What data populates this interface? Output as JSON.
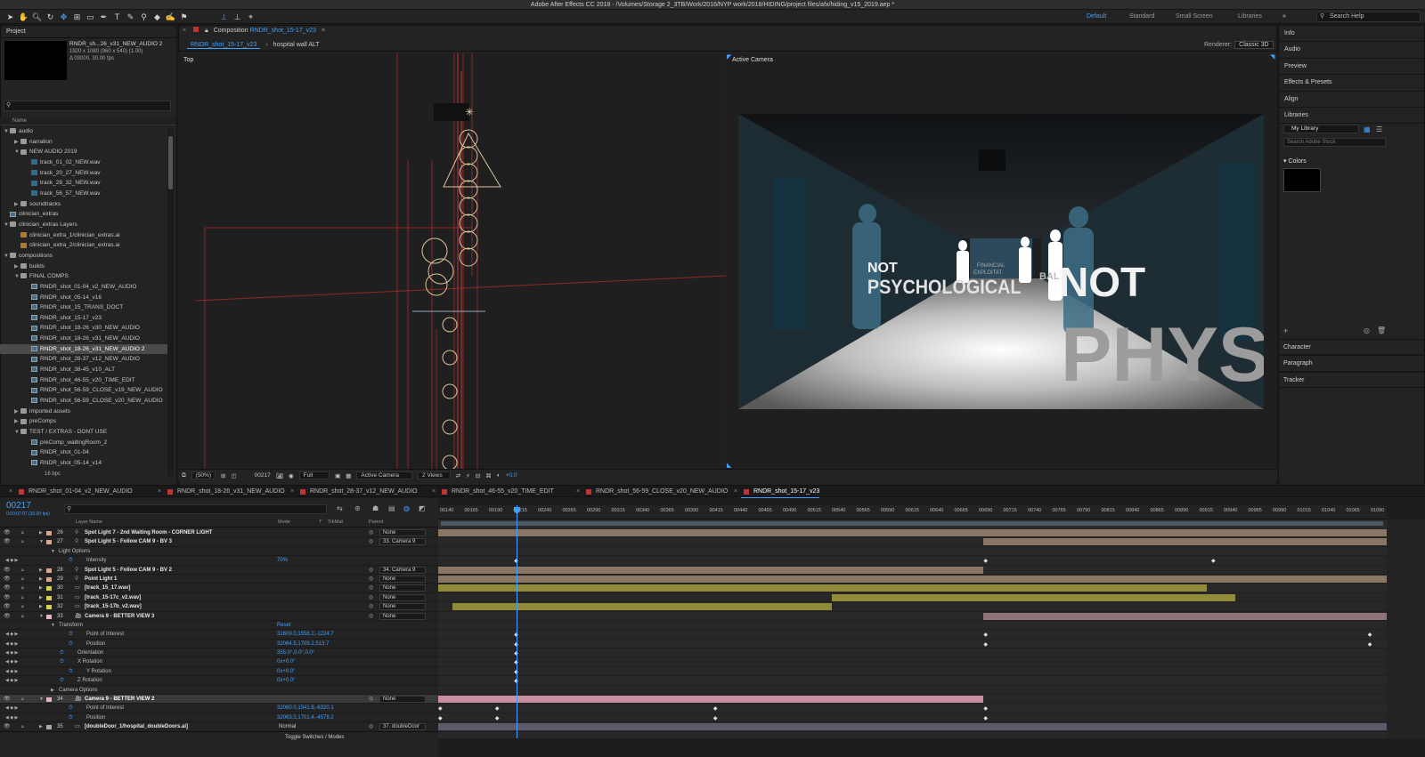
{
  "window_title": "Adobe After Effects CC 2018 - /Volumes/Storage 2_3TB/Work/2016/NYP work/2018/HIDING/project files/afx/hiding_v15_2019.aep *",
  "workspaces": [
    "Default",
    "Standard",
    "Small Screen",
    "Libraries"
  ],
  "search_help": "Search Help",
  "project": {
    "title": "Project",
    "selected_name": "RNDR_sh...26_v31_NEW_AUDIO 2",
    "info_line1": "1920 x 1080  (960 x 540) (1.00)",
    "info_line2": "Δ 03000, 30.00 fps",
    "name_header": "Name",
    "bpc": "16 bpc",
    "items": [
      {
        "label": "audio",
        "indent": 0,
        "icon": "folder",
        "open": true
      },
      {
        "label": "narration",
        "indent": 1,
        "icon": "folder",
        "open": false
      },
      {
        "label": "NEW AUDIO 2019",
        "indent": 1,
        "icon": "folder",
        "open": true
      },
      {
        "label": "track_01_02_NEW.wav",
        "indent": 2,
        "icon": "audio"
      },
      {
        "label": "track_20_27_NEW.wav",
        "indent": 2,
        "icon": "audio"
      },
      {
        "label": "track_28_32_NEW.wav",
        "indent": 2,
        "icon": "audio"
      },
      {
        "label": "track_56_57_NEW.wav",
        "indent": 2,
        "icon": "audio"
      },
      {
        "label": "soundtracks",
        "indent": 1,
        "icon": "folder",
        "open": false
      },
      {
        "label": "clinician_extras",
        "indent": 0,
        "icon": "comp"
      },
      {
        "label": "clinician_extras Layers",
        "indent": 0,
        "icon": "folder",
        "open": true
      },
      {
        "label": "clinician_extra_1/clinician_extras.ai",
        "indent": 1,
        "icon": "ai"
      },
      {
        "label": "clinician_extra_2/clinician_extras.ai",
        "indent": 1,
        "icon": "ai"
      },
      {
        "label": "compositions",
        "indent": 0,
        "icon": "folder",
        "open": true
      },
      {
        "label": "builds",
        "indent": 1,
        "icon": "folder",
        "open": false
      },
      {
        "label": "FINAL COMPS",
        "indent": 1,
        "icon": "folder",
        "open": true
      },
      {
        "label": "RNDR_shot_01-04_v2_NEW_AUDIO",
        "indent": 2,
        "icon": "comp"
      },
      {
        "label": "RNDR_shot_05-14_v16",
        "indent": 2,
        "icon": "comp"
      },
      {
        "label": "RNDR_shot_15_TRANS_DOCT",
        "indent": 2,
        "icon": "comp"
      },
      {
        "label": "RNDR_shot_15-17_v23",
        "indent": 2,
        "icon": "comp"
      },
      {
        "label": "RNDR_shot_18-26_v30_NEW_AUDIO",
        "indent": 2,
        "icon": "comp"
      },
      {
        "label": "RNDR_shot_18-26_v31_NEW_AUDIO",
        "indent": 2,
        "icon": "comp"
      },
      {
        "label": "RNDR_shot_18-26_v31_NEW_AUDIO 2",
        "indent": 2,
        "icon": "comp",
        "selected": true
      },
      {
        "label": "RNDR_shot_28-37_v12_NEW_AUDIO",
        "indent": 2,
        "icon": "comp"
      },
      {
        "label": "RNDR_shot_38-45_v10_ALT",
        "indent": 2,
        "icon": "comp"
      },
      {
        "label": "RNDR_shot_46-55_v20_TIME_EDIT",
        "indent": 2,
        "icon": "comp"
      },
      {
        "label": "RNDR_shot_56-59_CLOSE_v19_NEW_AUDIO",
        "indent": 2,
        "icon": "comp"
      },
      {
        "label": "RNDR_shot_56-59_CLOSE_v20_NEW_AUDIO",
        "indent": 2,
        "icon": "comp"
      },
      {
        "label": "imported assets",
        "indent": 1,
        "icon": "folder",
        "open": false
      },
      {
        "label": "preComps",
        "indent": 1,
        "icon": "folder",
        "open": false
      },
      {
        "label": "TEST / EXTRAS - DONT USE",
        "indent": 1,
        "icon": "folder",
        "open": true
      },
      {
        "label": "preComp_waitingRoom_2",
        "indent": 2,
        "icon": "comp"
      },
      {
        "label": "RNDR_shot_01-04",
        "indent": 2,
        "icon": "comp"
      },
      {
        "label": "RNDR_shot_05-14_v14",
        "indent": 2,
        "icon": "comp"
      }
    ]
  },
  "composition": {
    "tab_prefix": "Composition",
    "tab_name": "RNDR_shot_15-17_v23",
    "crumb_active": "RNDR_shot_15-17_v23",
    "crumb_next": "hospital wall ALT",
    "renderer_label": "Renderer:",
    "renderer_value": "Classic 3D",
    "left_view": "Top",
    "right_view": "Active Camera",
    "footer": {
      "magnification": "(50%)",
      "timecode": "00217",
      "resolution": "Full",
      "camera": "Active Camera",
      "views": "2 Views",
      "exposure": "+0.0"
    },
    "render_text": {
      "not_left": "NOT",
      "psych": "PSYCHOLOGICAL",
      "not_right": "NOT",
      "phys": "PHYS",
      "small1": "FINANCIAL",
      "small2": "EXPLOITAT",
      "small3": "BAL"
    }
  },
  "right_panels": {
    "top": [
      "Info",
      "Audio",
      "Preview",
      "Effects & Presets",
      "Align",
      "Libraries"
    ],
    "library_select": "My Library",
    "library_search": "Search Adobe Stock",
    "colors_label": "Colors",
    "bottom": [
      "Character",
      "Paragraph",
      "Tracker"
    ]
  },
  "timeline": {
    "tabs": [
      {
        "label": "RNDR_shot_01-04_v2_NEW_AUDIO",
        "active": false
      },
      {
        "label": "RNDR_shot_18-26_v31_NEW_AUDIO",
        "active": false
      },
      {
        "label": "RNDR_shot_28-37_v12_NEW_AUDIO",
        "active": false
      },
      {
        "label": "RNDR_shot_46-55_v20_TIME_EDIT",
        "active": false
      },
      {
        "label": "RNDR_shot_56-59_CLOSE_v20_NEW_AUDIO",
        "active": false
      },
      {
        "label": "RNDR_shot_15-17_v23",
        "active": true
      }
    ],
    "timecode": "00217",
    "timecode_sub": "0:00:07:07 (30.00 fps)",
    "headers": {
      "layer_name": "Layer Name",
      "mode": "Mode",
      "t": "T",
      "trkmat": "TrkMat",
      "parent": "Parent"
    },
    "ruler": [
      "00140",
      "00165",
      "00190",
      "00215",
      "00240",
      "00265",
      "00290",
      "00315",
      "00340",
      "00365",
      "00390",
      "00415",
      "00440",
      "00465",
      "00490",
      "00515",
      "00540",
      "00565",
      "00590",
      "00615",
      "00640",
      "00665",
      "00690",
      "00715",
      "00740",
      "00765",
      "00790",
      "00815",
      "00840",
      "00865",
      "00890",
      "00915",
      "00940",
      "00965",
      "00990",
      "01015",
      "01040",
      "01065",
      "01090"
    ],
    "toggle_label": "Toggle Switches / Modes",
    "rows": [
      {
        "type": "layer",
        "num": "26",
        "name": "Spot Light 7 - 2nd Waiting Room - CORNER LIGHT",
        "color": "#d9a68a",
        "parent": "None",
        "bar": {
          "from": 0.0,
          "to": 1.0,
          "color": "#8a7665"
        }
      },
      {
        "type": "layer",
        "num": "27",
        "name": "Spot Light 5 - Follow CAM 9 - BV 3",
        "color": "#d9a68a",
        "parent": "33. Camera 9",
        "bar": {
          "from": 0.575,
          "to": 1.0,
          "color": "#8a7665"
        }
      },
      {
        "type": "group",
        "label": "Light Options",
        "indent": 66
      },
      {
        "type": "prop",
        "label": "Intensity",
        "value": "70%",
        "indent": 97,
        "keys": [
          0.08,
          0.575,
          0.815
        ]
      },
      {
        "type": "layer",
        "num": "28",
        "name": "Spot Light 5 - Follow CAM 9 - BV 2",
        "color": "#d9a68a",
        "parent": "34. Camera 9",
        "bar": {
          "from": 0.0,
          "to": 0.575,
          "color": "#8a7665"
        }
      },
      {
        "type": "layer",
        "num": "29",
        "name": "Point Light 1",
        "color": "#d9a68a",
        "parent": "None",
        "bar": {
          "from": 0.0,
          "to": 1.0,
          "color": "#8a7665"
        }
      },
      {
        "type": "layer",
        "num": "30",
        "name": "[track_15_17.wav]",
        "color": "#d6d24a",
        "parent": "None",
        "bar": {
          "from": 0.0,
          "to": 0.81,
          "color": "#8f8b39"
        }
      },
      {
        "type": "layer",
        "num": "31",
        "name": "[track_15-17c_v2.wav]",
        "color": "#d6d24a",
        "parent": "None",
        "bar": {
          "from": 0.415,
          "to": 0.84,
          "color": "#8f8b39"
        }
      },
      {
        "type": "layer",
        "num": "32",
        "name": "[track_15-17b_v2.wav]",
        "color": "#d6d24a",
        "parent": "None",
        "bar": {
          "from": 0.015,
          "to": 0.415,
          "color": "#8f8b39"
        }
      },
      {
        "type": "layer",
        "num": "33",
        "name": "Camera 9 - BETTER VIEW 3",
        "color": "#e6b7c0",
        "parent": "None",
        "bar": {
          "from": 0.575,
          "to": 1.0,
          "color": "#8c7479"
        }
      },
      {
        "type": "group",
        "label": "Transform",
        "indent": 66,
        "value": "Reset"
      },
      {
        "type": "prop",
        "label": "Point of Interest",
        "value": "31609.0,1556.2,-1224.7",
        "indent": 97,
        "keys": [
          0.08,
          0.575,
          0.98
        ]
      },
      {
        "type": "prop",
        "label": "Position",
        "value": "32064.5,1709.2,513.7",
        "indent": 97,
        "keys": [
          0.08,
          0.575,
          0.98
        ]
      },
      {
        "type": "prop",
        "label": "Orientation",
        "value": "355.0°,0.0°,0.0°",
        "indent": 87,
        "keys": [
          0.08
        ]
      },
      {
        "type": "prop",
        "label": "X Rotation",
        "value": "0x+0.0°",
        "indent": 87,
        "keys": [
          0.08
        ]
      },
      {
        "type": "prop",
        "label": "Y Rotation",
        "value": "0x+0.0°",
        "indent": 97,
        "keys": [
          0.08
        ]
      },
      {
        "type": "prop",
        "label": "Z Rotation",
        "value": "0x+0.0°",
        "indent": 87,
        "keys": [
          0.08
        ]
      },
      {
        "type": "group",
        "label": "Camera Options",
        "indent": 66
      },
      {
        "type": "layer",
        "num": "34",
        "name": "Camera 9 - BETTER VIEW 2",
        "color": "#e6b7c0",
        "parent": "None",
        "highlight": true,
        "bar": {
          "from": 0.0,
          "to": 0.575,
          "color": "#c98ea0"
        }
      },
      {
        "type": "prop",
        "label": "Point of Interest",
        "value": "32060.0,1541.8,-6320.1",
        "indent": 97,
        "keys": [
          0.0,
          0.06,
          0.29,
          0.575
        ]
      },
      {
        "type": "prop",
        "label": "Position",
        "value": "32063.5,1701.4,-4579.2",
        "indent": 97,
        "keys": [
          0.0,
          0.06,
          0.29,
          0.575
        ]
      },
      {
        "type": "layer",
        "num": "35",
        "name": "[doubleDoor_1/hospital_doubleDoors.ai]",
        "color": "#a9a9a9",
        "parent": "37. doubleDoor",
        "mode": "Normal",
        "bar": {
          "from": 0.0,
          "to": 1.0,
          "color": "#5b5b6b"
        }
      }
    ]
  }
}
